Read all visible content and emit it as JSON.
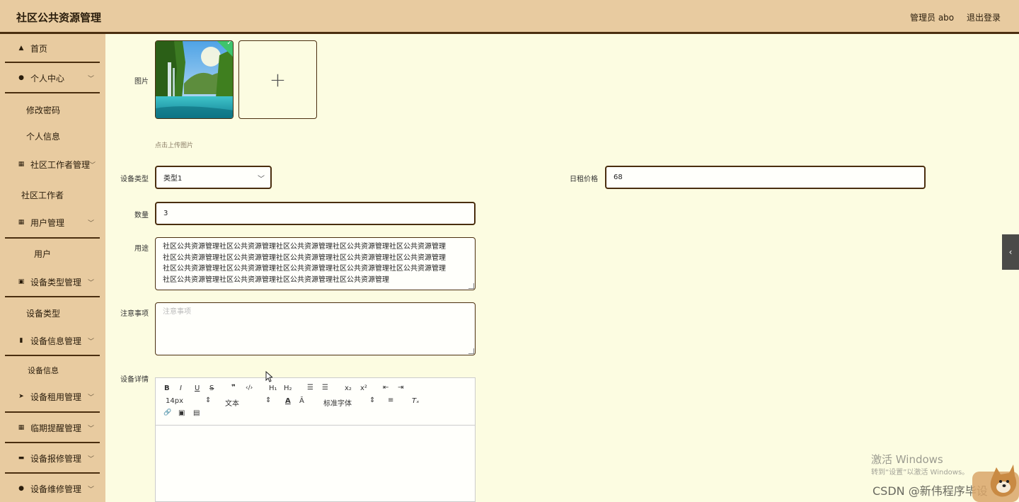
{
  "header": {
    "title": "社区公共资源管理",
    "user": "管理员 abo",
    "logout": "退出登录"
  },
  "sidebar": {
    "items": [
      {
        "label": "首页",
        "icon": "home-icon"
      },
      {
        "label": "个人中心",
        "icon": "user-icon",
        "subs": [
          "修改密码",
          "个人信息"
        ]
      },
      {
        "label": "社区工作者管理",
        "icon": "grid-icon",
        "subs": [
          "社区工作者"
        ]
      },
      {
        "label": "用户管理",
        "icon": "grid-icon",
        "subs": [
          "用户"
        ]
      },
      {
        "label": "设备类型管理",
        "icon": "clipboard-icon",
        "subs": [
          "设备类型"
        ]
      },
      {
        "label": "设备信息管理",
        "icon": "bar-chart-icon",
        "subs": [
          "设备信息"
        ]
      },
      {
        "label": "设备租用管理",
        "icon": "send-icon"
      },
      {
        "label": "临期提醒管理",
        "icon": "grid-icon"
      },
      {
        "label": "设备报修管理",
        "icon": "monitor-icon"
      },
      {
        "label": "设备维修管理",
        "icon": "user-icon"
      }
    ]
  },
  "form": {
    "image_label": "图片",
    "upload_plus": "+",
    "upload_hint": "点击上传图片",
    "type_label": "设备类型",
    "type_value": "类型1",
    "price_label": "日租价格",
    "price_value": "68",
    "qty_label": "数量",
    "qty_value": "3",
    "usage_label": "用途",
    "usage_lines": [
      "社区公共资源管理社区公共资源管理社区公共资源管理社区公共资源管理社区公共资源管理",
      "社区公共资源管理社区公共资源管理社区公共资源管理社区公共资源管理社区公共资源管理",
      "社区公共资源管理社区公共资源管理社区公共资源管理社区公共资源管理社区公共资源管理",
      "社区公共资源管理社区公共资源管理社区公共资源管理社区公共资源管理"
    ],
    "notes_label": "注意事项",
    "notes_placeholder": "注意事项",
    "detail_label": "设备详情"
  },
  "editor": {
    "bold": "B",
    "italic": "I",
    "underline": "U",
    "strike": "S",
    "quote": "❞",
    "code": "‹/›",
    "h1": "H₁",
    "h2": "H₂",
    "ol": "☰",
    "ul": "☰",
    "sub": "x₂",
    "sup": "x²",
    "outdent": "⇤",
    "indent": "⇥",
    "size": "14px",
    "text": "文本",
    "color": "A",
    "bg": "Ā",
    "font": "标准字体",
    "align": "≡",
    "clear": "Tₓ",
    "link": "🔗",
    "image": "▣",
    "video": "▤"
  },
  "watermark": {
    "line1": "激活 Windows",
    "line2": "转到“设置”以激活 Windows。",
    "csdn": "CSDN @新伟程序毕设"
  }
}
